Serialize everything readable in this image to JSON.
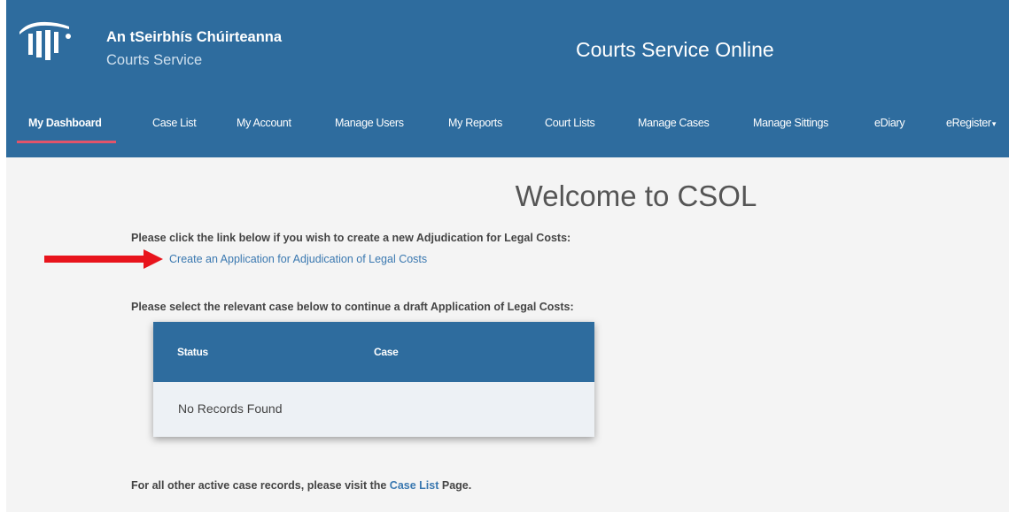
{
  "header": {
    "brand_irish": "An tSeirbhís Chúirteanna",
    "brand_english": "Courts Service",
    "site_title": "Courts Service Online",
    "logo_icon": "courts-service-logo"
  },
  "nav": {
    "items": [
      {
        "label": "My Dashboard",
        "active": true
      },
      {
        "label": "Case List"
      },
      {
        "label": "My Account"
      },
      {
        "label": "Manage Users"
      },
      {
        "label": "My Reports"
      },
      {
        "label": "Court Lists"
      },
      {
        "label": "Manage Cases"
      },
      {
        "label": "Manage Sittings"
      },
      {
        "label": "eDiary"
      },
      {
        "label": "eRegister"
      }
    ],
    "dropdown_caret": "▾"
  },
  "main": {
    "welcome": "Welcome to CSOL",
    "instruction_new": "Please click the link below if you wish to create a new Adjudication for Legal Costs:",
    "create_link": "Create an Application for Adjudication of Legal Costs",
    "instruction_draft": "Please select the relevant case below to continue a draft Application of Legal Costs:",
    "table": {
      "columns": [
        "Status",
        "Case"
      ],
      "empty_message": "No Records Found"
    },
    "footer": {
      "prefix": "For all other active case records, please visit the ",
      "link": "Case List",
      "suffix": " Page."
    }
  },
  "colors": {
    "brand_blue": "#2e6c9e",
    "active_underline": "#e2546a",
    "link": "#3a78b0",
    "annotation_arrow": "#e8141c"
  }
}
